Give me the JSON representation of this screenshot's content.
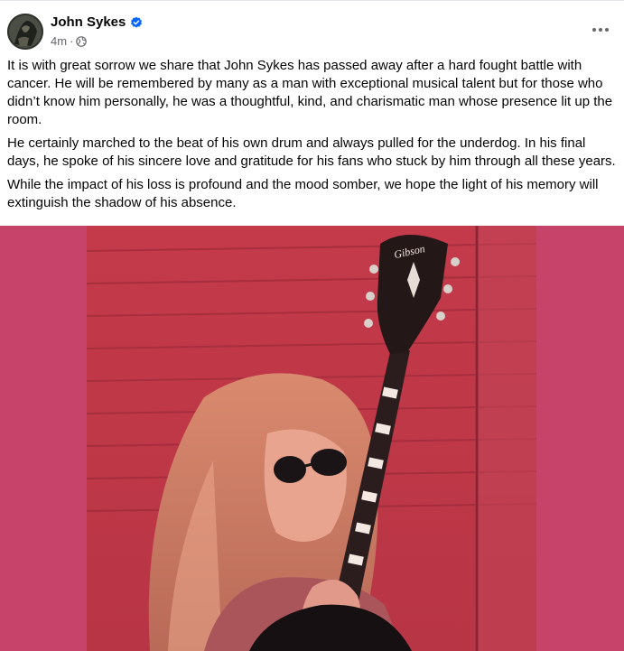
{
  "post": {
    "author_name": "John Sykes",
    "timestamp": "4m",
    "separator": "·",
    "privacy_icon": "globe-icon",
    "verified_icon": "verified-badge-icon",
    "more_icon": "more-options-icon",
    "paragraphs": [
      "It is with great sorrow we share that John Sykes has passed away after a hard fought battle with cancer. He will be remembered by many as a man with exceptional musical talent but for those who didn’t know him personally, he was a thoughtful, kind, and charismatic man whose presence lit up the room.",
      "He certainly marched to the beat of his own drum and always pulled for the underdog. In his final days, he spoke of his sincere love and gratitude for his fans who stuck by him through all these years.",
      "While the impact of his loss is profound and the mood somber, we hope the light of his memory will extinguish the shadow of his absence."
    ],
    "guitar_headstock_text": "Gibson"
  },
  "colors": {
    "photo_background": "#c8436a",
    "verified_blue": "#0866ff",
    "meta_gray": "#65676b"
  }
}
